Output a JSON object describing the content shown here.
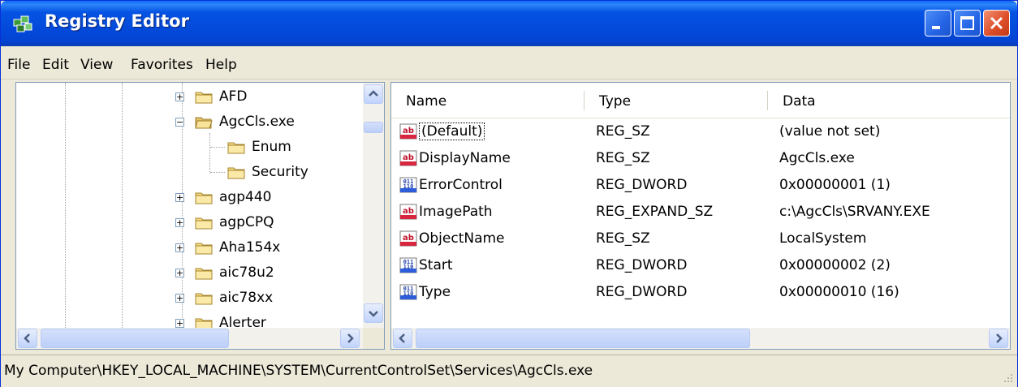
{
  "window": {
    "title": "Registry Editor"
  },
  "menu": [
    "File",
    "Edit",
    "View",
    "Favorites",
    "Help"
  ],
  "tree": {
    "items": [
      {
        "label": "AFD",
        "expander": "+",
        "level": 0
      },
      {
        "label": "AgcCls.exe",
        "expander": "−",
        "level": 0,
        "open": true
      },
      {
        "label": "Enum",
        "expander": "",
        "level": 1
      },
      {
        "label": "Security",
        "expander": "",
        "level": 1
      },
      {
        "label": "agp440",
        "expander": "+",
        "level": 0
      },
      {
        "label": "agpCPQ",
        "expander": "+",
        "level": 0
      },
      {
        "label": "Aha154x",
        "expander": "+",
        "level": 0
      },
      {
        "label": "aic78u2",
        "expander": "+",
        "level": 0
      },
      {
        "label": "aic78xx",
        "expander": "+",
        "level": 0
      },
      {
        "label": "Alerter",
        "expander": "+",
        "level": 0
      }
    ]
  },
  "list": {
    "columns": [
      "Name",
      "Type",
      "Data"
    ],
    "rows": [
      {
        "icon": "string-value-icon",
        "name": "(Default)",
        "type": "REG_SZ",
        "data": "(value not set)"
      },
      {
        "icon": "string-value-icon",
        "name": "DisplayName",
        "type": "REG_SZ",
        "data": "AgcCls.exe"
      },
      {
        "icon": "binary-value-icon",
        "name": "ErrorControl",
        "type": "REG_DWORD",
        "data": "0x00000001 (1)"
      },
      {
        "icon": "string-value-icon",
        "name": "ImagePath",
        "type": "REG_EXPAND_SZ",
        "data": "c:\\AgcCls\\SRVANY.EXE"
      },
      {
        "icon": "string-value-icon",
        "name": "ObjectName",
        "type": "REG_SZ",
        "data": "LocalSystem"
      },
      {
        "icon": "binary-value-icon",
        "name": "Start",
        "type": "REG_DWORD",
        "data": "0x00000002 (2)"
      },
      {
        "icon": "binary-value-icon",
        "name": "Type",
        "type": "REG_DWORD",
        "data": "0x00000010 (16)"
      }
    ]
  },
  "status": {
    "path": "My Computer\\HKEY_LOCAL_MACHINE\\SYSTEM\\CurrentControlSet\\Services\\AgcCls.exe"
  }
}
